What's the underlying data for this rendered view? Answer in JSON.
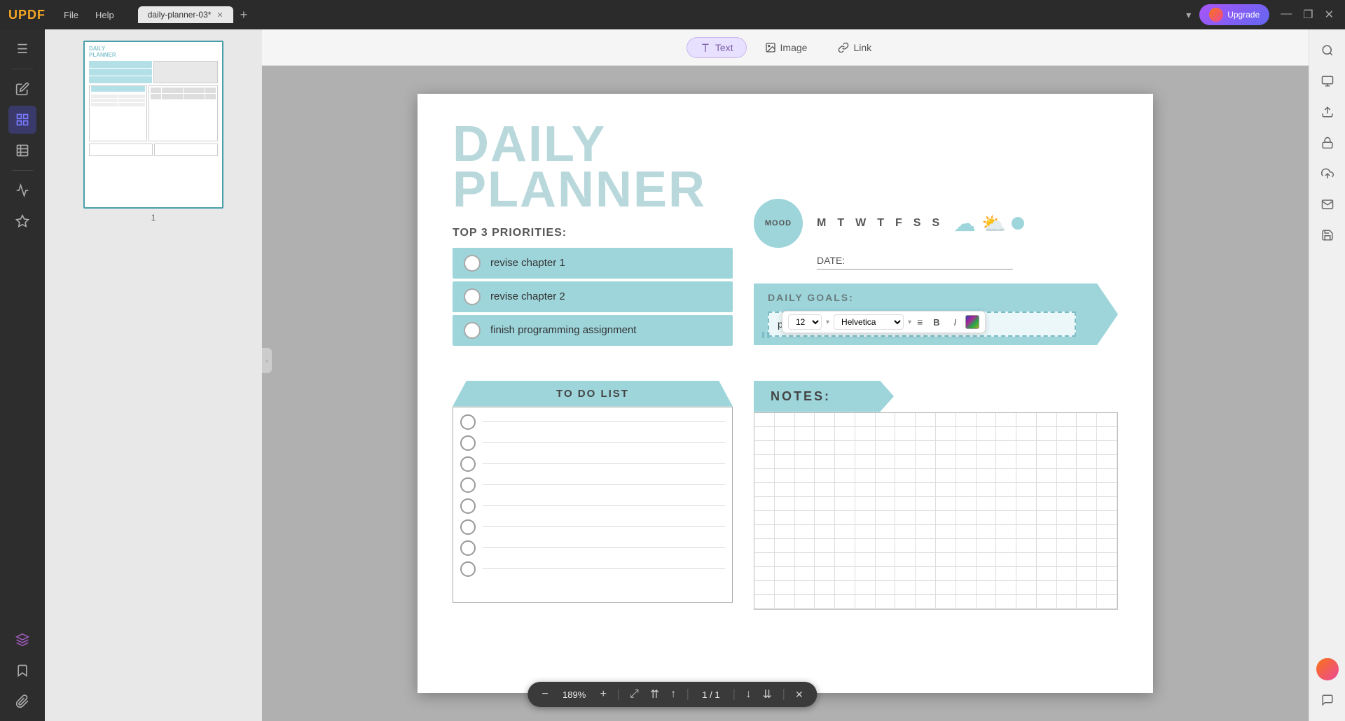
{
  "app": {
    "logo": "UPDF",
    "tab_name": "daily-planner-03*",
    "dropdown_arrow": "▾",
    "upgrade_label": "Upgrade",
    "window_minimize": "—",
    "window_maximize": "❐",
    "window_close": "✕"
  },
  "menu": {
    "items": [
      "File",
      "Help"
    ]
  },
  "toolbar": {
    "text_label": "Text",
    "image_label": "Image",
    "link_label": "Link"
  },
  "text_toolbar": {
    "font_size": "12",
    "font_family": "Helvetica",
    "align_icon": "≡",
    "bold_label": "B",
    "italic_label": "I"
  },
  "page": {
    "title_line1": "DAILY",
    "title_line2": "PLANNER",
    "priorities_label": "TOP 3 PRIORITIES:",
    "priority_items": [
      {
        "text": "revise chapter 1"
      },
      {
        "text": "revise chapter 2"
      },
      {
        "text": "finish programming assignment"
      }
    ],
    "mood_label": "MOOD",
    "days": [
      "M",
      "T",
      "W",
      "T",
      "F",
      "S",
      "S"
    ],
    "date_label": "DATE:",
    "daily_goals_label": "DAILY GOALS:",
    "daily_goals_text": "prepare for Web Development quiz",
    "todo_label": "TO DO LIST",
    "notes_label": "NOTES:",
    "todo_rows": 8
  },
  "zoom": {
    "zoom_out": "−",
    "percent": "189%",
    "zoom_in": "+",
    "page_current": "1",
    "page_total": "1",
    "separator": "|",
    "nav_top": "⇈",
    "nav_up": "↑",
    "nav_down": "↓",
    "nav_bottom": "⇊",
    "close": "✕"
  },
  "thumbnail": {
    "page_num": "1"
  },
  "sidebar": {
    "icons": [
      {
        "name": "document-icon",
        "symbol": "☰"
      },
      {
        "name": "edit-icon",
        "symbol": "✏"
      },
      {
        "name": "pages-icon",
        "symbol": "⊞",
        "active": true
      },
      {
        "name": "table-icon",
        "symbol": "⊟"
      },
      {
        "name": "chart-icon",
        "symbol": "↗"
      },
      {
        "name": "sticker-icon",
        "symbol": "★"
      },
      {
        "name": "layers-icon",
        "symbol": "◈"
      },
      {
        "name": "bookmark-icon",
        "symbol": "🔖"
      },
      {
        "name": "clip-icon",
        "symbol": "📎"
      }
    ]
  },
  "right_panel": {
    "icons": [
      {
        "name": "fit-page-icon",
        "symbol": "⊡"
      },
      {
        "name": "export-icon",
        "symbol": "⇱"
      },
      {
        "name": "lock-icon",
        "symbol": "🔒"
      },
      {
        "name": "upload-icon",
        "symbol": "⬆"
      },
      {
        "name": "mail-icon",
        "symbol": "✉"
      },
      {
        "name": "save-icon",
        "symbol": "💾"
      }
    ]
  }
}
